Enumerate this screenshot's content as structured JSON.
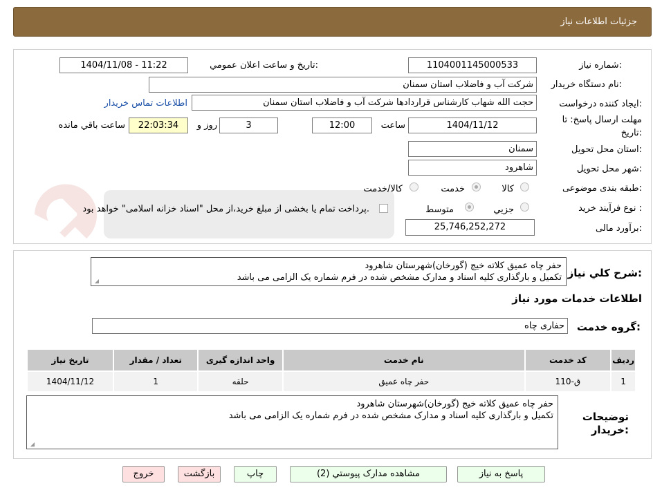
{
  "header": {
    "title": "جزئیات اطلاعات نیاز"
  },
  "form": {
    "need_number_label": "شماره نیاز:",
    "need_number": "1104001145000533",
    "announce_label": "تاریخ و ساعت اعلان عمومي:",
    "announce_value": "1404/11/08 - 11:22",
    "buyer_org_label": "نام دستگاه خريدار:",
    "buyer_org": "شرکت آب و فاضلاب استان سمنان",
    "creator_label": "ايجاد كننده درخواست:",
    "creator": "حجت الله شهاب کارشناس قراردادها شرکت آب و فاضلاب استان سمنان",
    "contact_link": "اطلاعات تماس خريدار",
    "deadline_label_1": "مهلت ارسال پاسخ: تا",
    "deadline_label_2": "تاريخ:",
    "deadline_date": "1404/11/12",
    "time_label": "ساعت",
    "deadline_time": "12:00",
    "days_value": "3",
    "days_label": "روز و",
    "remaining_time": "22:03:34",
    "remaining_label": "ساعت باقي مانده",
    "province_label": "استان محل تحويل:",
    "province": "سمنان",
    "city_label": "شهر محل تحويل:",
    "city": "شاهرود",
    "category_label": "طبقه بندی موضوعی:",
    "category_options": [
      "کالا",
      "خدمت",
      "کالا/خدمت"
    ],
    "category_selected": "خدمت",
    "process_label": "نوع فرآيند خريد :",
    "process_options": [
      "جزيي",
      "متوسط"
    ],
    "process_selected": "متوسط",
    "payment_note": "پرداخت تمام يا بخشی از مبلغ خريد،از محل \"اسناد خزانه اسلامی\" خواهد بود.",
    "budget_label": "برآورد مالی:",
    "budget": "25,746,252,272"
  },
  "description": {
    "label": "شرح کلي نياز:",
    "lines": [
      "حفر چاه عمیق کلاته خیج (گورخان)شهرستان شاهرود",
      "تکمیل و بارگذاری کلیه اسناد و مدارک مشخص شده در فرم شماره یک الزامی می باشد"
    ]
  },
  "services": {
    "section_title": "اطلاعات خدمات مورد نياز",
    "group_label": "گروه خدمت:",
    "group_value": "حفاری چاه",
    "columns": [
      "رديف",
      "کد خدمت",
      "نام خدمت",
      "واحد اندازه گيری",
      "تعداد / مقدار",
      "تاريخ نياز"
    ],
    "rows": [
      [
        "1",
        "ق-110",
        "حفر چاه عمیق",
        "حلقه",
        "1",
        "1404/11/12"
      ]
    ]
  },
  "buyer_notes": {
    "label_1": "توضيحات",
    "label_2": "خريدار:",
    "lines": [
      "حفر چاه عمیق کلاته خیج (گورخان)شهرستان شاهرود",
      "تکمیل و بارگذاری کلیه اسناد و مدارک مشخص شده در فرم شماره یک الزامی می باشد"
    ]
  },
  "buttons": {
    "respond": "پاسخ به نياز",
    "attachments": "مشاهده مدارک پيوستي (2)",
    "print": "چاپ",
    "back": "بازگشت",
    "exit": "خروج"
  },
  "colors": {
    "title_bar": "#8b6a3e",
    "button_green": "#ebffeb",
    "button_pink": "#ffe0e0",
    "link": "#1a4fa8",
    "watermark": "#c0392b"
  }
}
